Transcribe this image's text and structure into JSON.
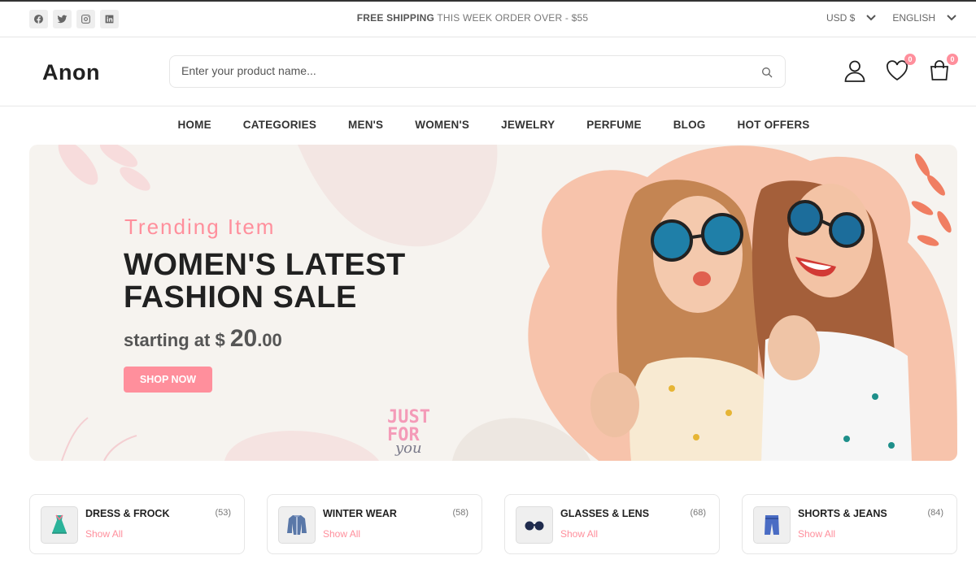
{
  "topbar": {
    "social_icons": [
      "facebook-icon",
      "twitter-icon",
      "instagram-icon",
      "linkedin-icon"
    ],
    "shipping_bold": "FREE SHIPPING",
    "shipping_rest": " THIS WEEK ORDER OVER - $55",
    "currency": "USD $",
    "language": "ENGLISH"
  },
  "header": {
    "logo": "Anon",
    "search_placeholder": "Enter your product name...",
    "wishlist_count": "0",
    "cart_count": "0"
  },
  "nav": {
    "items": [
      "HOME",
      "CATEGORIES",
      "MEN'S",
      "WOMEN'S",
      "JEWELRY",
      "PERFUME",
      "BLOG",
      "HOT OFFERS"
    ]
  },
  "banner": {
    "subtitle": "Trending Item",
    "title": "WOMEN'S LATEST FASHION SALE",
    "price_prefix": "starting at $ ",
    "price_whole": "20",
    "price_cents": ".00",
    "button": "SHOP NOW",
    "art_line1": "JUST",
    "art_line2": "FOR",
    "art_line3": "you"
  },
  "categories": [
    {
      "name": "DRESS & FROCK",
      "count": "(53)",
      "link": "Show All",
      "icon": "dress-icon"
    },
    {
      "name": "WINTER WEAR",
      "count": "(58)",
      "link": "Show All",
      "icon": "coat-icon"
    },
    {
      "name": "GLASSES & LENS",
      "count": "(68)",
      "link": "Show All",
      "icon": "glasses-icon"
    },
    {
      "name": "SHORTS & JEANS",
      "count": "(84)",
      "link": "Show All",
      "icon": "jeans-icon"
    }
  ],
  "colors": {
    "accent": "#ff8f9c",
    "text_dark": "#212121",
    "banner_bg": "#f6f3ef",
    "heart_blob": "#f7c3ab"
  }
}
